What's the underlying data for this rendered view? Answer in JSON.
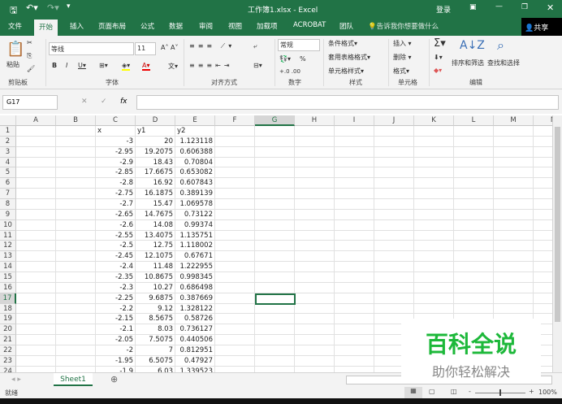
{
  "window": {
    "title": "工作簿1.xlsx - Excel",
    "login": "登录"
  },
  "tabs": [
    "文件",
    "开始",
    "插入",
    "页面布局",
    "公式",
    "数据",
    "审阅",
    "视图",
    "加载项",
    "ACROBAT",
    "团队"
  ],
  "tell_me": "告诉我你想要做什么",
  "share": "共享",
  "ribbon": {
    "paste": "粘贴",
    "font_name": "等线",
    "font_size": "11",
    "number_format": "常规",
    "percent": "%",
    "cond_format": "条件格式",
    "table_format": "套用表格格式",
    "cell_style": "单元格样式",
    "insert": "插入",
    "delete": "删除",
    "format": "格式",
    "sort_filter": "排序和筛选",
    "find_select": "查找和选择",
    "groups": [
      "剪贴板",
      "字体",
      "对齐方式",
      "数字",
      "样式",
      "单元格",
      "编辑"
    ]
  },
  "formula": {
    "name_box": "G17",
    "fx": "fx",
    "value": ""
  },
  "columns": [
    "A",
    "B",
    "C",
    "D",
    "E",
    "F",
    "G",
    "H",
    "I",
    "J",
    "K",
    "L",
    "M",
    "N"
  ],
  "rows": [
    [
      "",
      "",
      "x",
      "y1",
      "y2"
    ],
    [
      "",
      "",
      "-3",
      "20",
      "1.123118"
    ],
    [
      "",
      "",
      "-2.95",
      "19.2075",
      "0.606388"
    ],
    [
      "",
      "",
      "-2.9",
      "18.43",
      "0.70804"
    ],
    [
      "",
      "",
      "-2.85",
      "17.6675",
      "0.653082"
    ],
    [
      "",
      "",
      "-2.8",
      "16.92",
      "0.607843"
    ],
    [
      "",
      "",
      "-2.75",
      "16.1875",
      "0.389139"
    ],
    [
      "",
      "",
      "-2.7",
      "15.47",
      "1.069578"
    ],
    [
      "",
      "",
      "-2.65",
      "14.7675",
      "0.73122"
    ],
    [
      "",
      "",
      "-2.6",
      "14.08",
      "0.99374"
    ],
    [
      "",
      "",
      "-2.55",
      "13.4075",
      "1.135751"
    ],
    [
      "",
      "",
      "-2.5",
      "12.75",
      "1.118002"
    ],
    [
      "",
      "",
      "-2.45",
      "12.1075",
      "0.67671"
    ],
    [
      "",
      "",
      "-2.4",
      "11.48",
      "1.222955"
    ],
    [
      "",
      "",
      "-2.35",
      "10.8675",
      "0.998345"
    ],
    [
      "",
      "",
      "-2.3",
      "10.27",
      "0.686498"
    ],
    [
      "",
      "",
      "-2.25",
      "9.6875",
      "0.387669"
    ],
    [
      "",
      "",
      "-2.2",
      "9.12",
      "1.328122"
    ],
    [
      "",
      "",
      "-2.15",
      "8.5675",
      "0.58726"
    ],
    [
      "",
      "",
      "-2.1",
      "8.03",
      "0.736127"
    ],
    [
      "",
      "",
      "-2.05",
      "7.5075",
      "0.440506"
    ],
    [
      "",
      "",
      "-2",
      "7",
      "0.812951"
    ],
    [
      "",
      "",
      "-1.95",
      "6.5075",
      "0.47927"
    ],
    [
      "",
      "",
      "-1.9",
      "6.03",
      "1.339523"
    ]
  ],
  "selected_cell": "G17",
  "sheet_tab": "Sheet1",
  "status": {
    "ready": "就绪",
    "zoom": "100%"
  },
  "watermark": {
    "title": "百科全说",
    "subtitle": "助你轻松解决"
  }
}
